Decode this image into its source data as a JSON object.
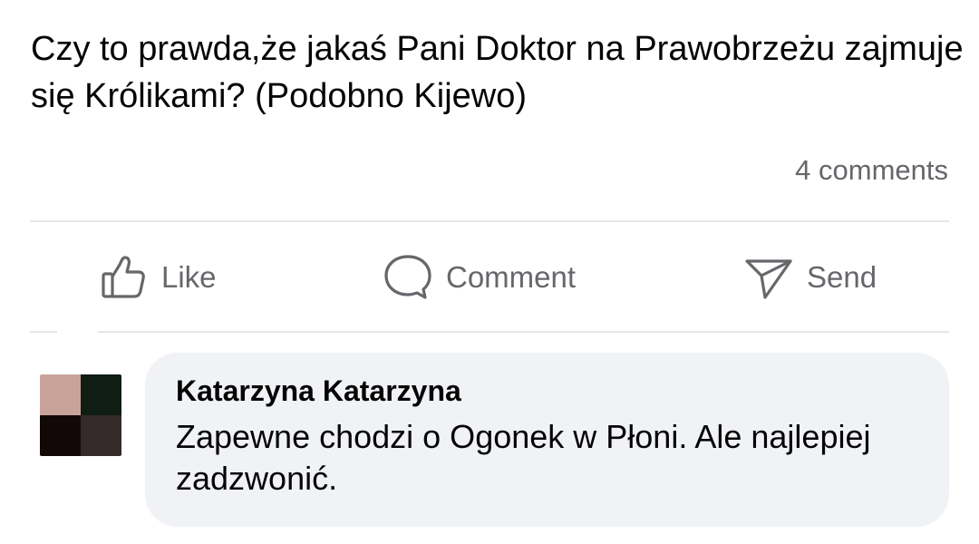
{
  "post": {
    "text": "Czy to prawda,że jakaś Pani Doktor na Prawobrzeżu zajmuje się Królikami? (Podobno Kijewo)",
    "comments_count": "4 comments"
  },
  "actions": {
    "like_label": "Like",
    "comment_label": "Comment",
    "send_label": "Send",
    "icon_color": "#65676b"
  },
  "comment": {
    "author": "Katarzyna Katarzyna",
    "text": "Zapewne chodzi o Ogonek w Płoni. Ale najlepiej zadzwonić.",
    "bubble_color": "#f0f2f5"
  }
}
